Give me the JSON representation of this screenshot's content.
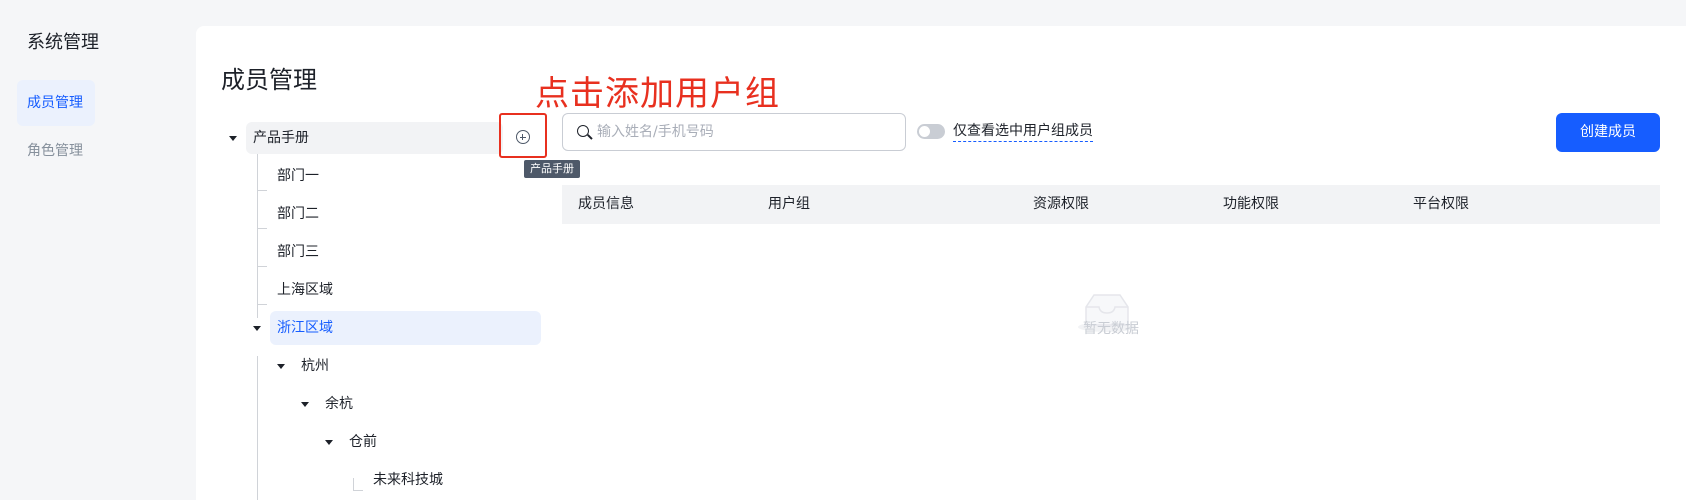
{
  "sidebar": {
    "title": "系统管理",
    "items": [
      {
        "label": "成员管理",
        "active": true
      },
      {
        "label": "角色管理",
        "active": false
      }
    ]
  },
  "page": {
    "title": "成员管理"
  },
  "annotation": "点击添加用户组",
  "tree": {
    "root": "产品手册",
    "tooltip": "产品手册",
    "nodes": [
      "部门一",
      "部门二",
      "部门三",
      "上海区域",
      "浙江区域",
      "杭州",
      "余杭",
      "仓前",
      "未来科技城"
    ],
    "selected": "浙江区域"
  },
  "search": {
    "placeholder": "输入姓名/手机号码",
    "value": ""
  },
  "filter": {
    "label": "仅查看选中用户组成员",
    "checked": false
  },
  "toolbar": {
    "create_label": "创建成员"
  },
  "table": {
    "columns": [
      "成员信息",
      "用户组",
      "资源权限",
      "功能权限",
      "平台权限"
    ],
    "rows": [],
    "empty_text": "暂无数据"
  },
  "colors": {
    "primary": "#165dff",
    "annotation": "#e8301f",
    "selected_bg": "#ebf1fd"
  }
}
